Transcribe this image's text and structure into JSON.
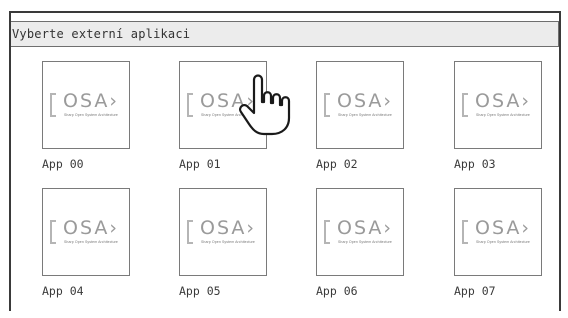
{
  "header": {
    "title": "Vyberte externí aplikaci"
  },
  "logo": {
    "text": "OSA›",
    "subtext": "Sharp Open System Architecture"
  },
  "apps": [
    {
      "label": "App 00"
    },
    {
      "label": "App 01"
    },
    {
      "label": "App 02"
    },
    {
      "label": "App 03"
    },
    {
      "label": "App 04"
    },
    {
      "label": "App 05"
    },
    {
      "label": "App 06"
    },
    {
      "label": "App 07"
    }
  ],
  "pointer": {
    "icon": "hand-pointer-icon"
  }
}
